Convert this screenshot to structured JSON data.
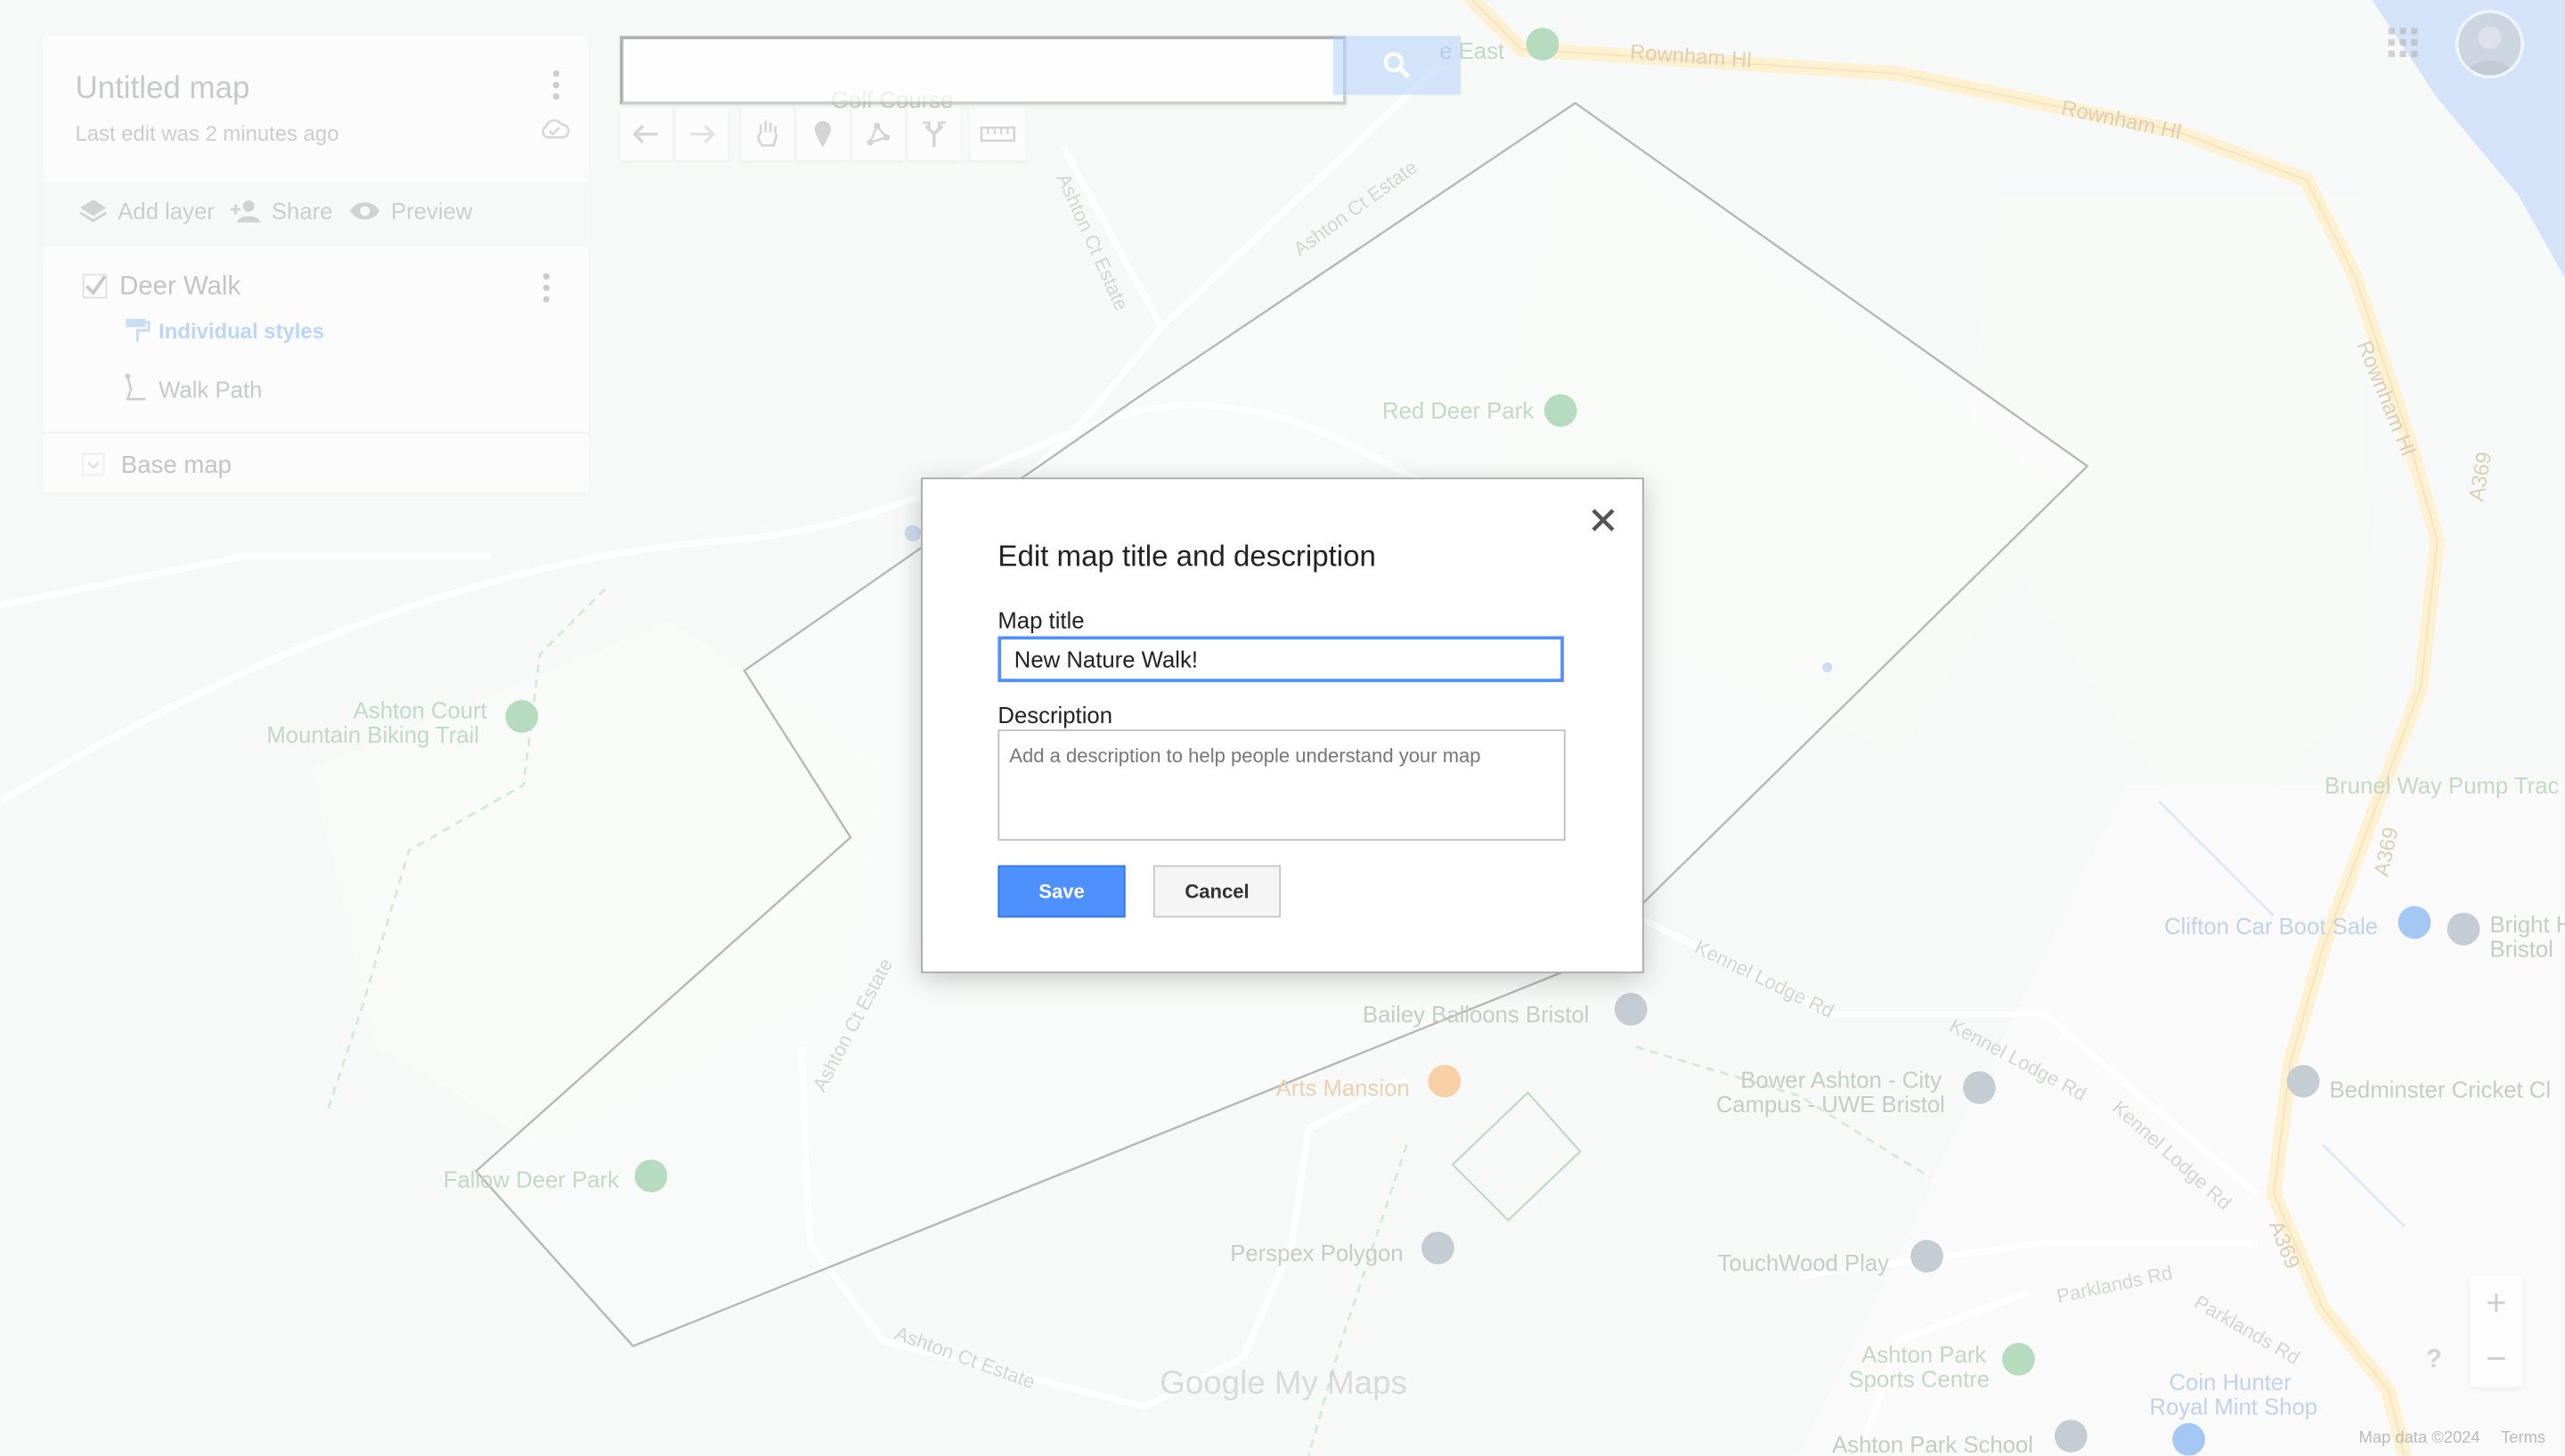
{
  "panel": {
    "title": "Untitled map",
    "subtitle": "Last edit was 2 minutes ago",
    "actions": {
      "add_layer": "Add layer",
      "share": "Share",
      "preview": "Preview"
    },
    "layer": {
      "title": "Deer Walk",
      "checked": true,
      "style_link": "Individual styles",
      "feature": "Walk Path"
    },
    "base_map": "Base map"
  },
  "search": {
    "value": "",
    "placeholder": ""
  },
  "map_labels": {
    "golf": "Golf Course",
    "east": "e East",
    "rownham1": "Rownham Hl",
    "rownham2": "Rownham Hl",
    "rownham3": "Rownham Hl",
    "ashton_estate1": "Ashton Ct Estate",
    "ashton_estate2": "Ashton Ct Estate",
    "ashton_estate3": "Ashton Ct Estate",
    "ashton_estate4": "Ashton Ct Estate",
    "red_deer": "Red Deer Park",
    "biking1": "Ashton Court",
    "biking2": "Mountain Biking Trail",
    "brunel": "Brunel Way Pump Trac",
    "clifton_boot": "Clifton Car Boot Sale",
    "bright1": "Bright H",
    "bright2": "Bristol",
    "kennel1": "Kennel Lodge Rd",
    "kennel2": "Kennel Lodge Rd",
    "kennel3": "Kennel Lodge Rd",
    "bailey": "Bailey Balloons Bristol",
    "arts": "Arts Mansion",
    "bower1": "Bower Ashton - City",
    "bower2": "Campus - UWE Bristol",
    "bedminster": "Bedminster Cricket Cl",
    "fallow": "Fallow Deer Park",
    "perspex": "Perspex Polygon",
    "touchwood": "TouchWood Play",
    "parklands1": "Parklands Rd",
    "parklands2": "Parklands Rd",
    "sports1": "Ashton Park",
    "sports2": "Sports Centre",
    "coin1": "Coin Hunter",
    "coin2": "Royal Mint Shop",
    "school": "Ashton Park School",
    "a369a": "A369",
    "a369b": "A369",
    "a369c": "A369"
  },
  "brand": "Google My Maps",
  "footer": {
    "data": "Map data ©2024",
    "terms": "Terms"
  },
  "zoom": {
    "in": "+",
    "out": "−"
  },
  "help": "?",
  "dialog": {
    "heading": "Edit map title and description",
    "title_label": "Map title",
    "title_value": "New Nature Walk!",
    "description_label": "Description",
    "description_placeholder": "Add a description to help people understand your map",
    "save": "Save",
    "cancel": "Cancel"
  },
  "colors": {
    "accent": "#4d90fe",
    "map_bg": "#edf3ee",
    "major_road": "#fbe2a3",
    "water": "#aac6f0",
    "polygon": "#707070"
  }
}
